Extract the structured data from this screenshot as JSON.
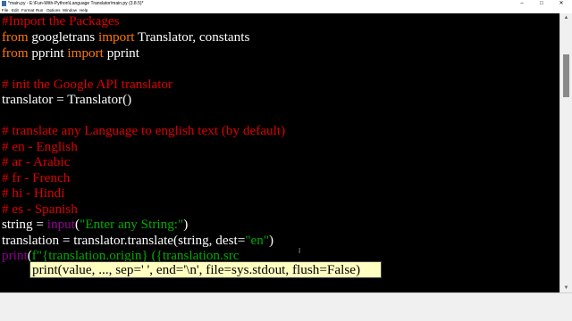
{
  "window": {
    "title": "*main.py - E:\\Fun-With-Python\\Language Translator\\main.py (3.8.5)*",
    "minimize_glyph": "–",
    "maximize_glyph": "□",
    "close_glyph": "✕"
  },
  "menu": [
    "File",
    "Edit",
    "Format",
    "Run",
    "Options",
    "Window",
    "Help"
  ],
  "code": {
    "line1_comment": "#Import the Packages",
    "line2_from": "from",
    "line2_mod": " googletrans ",
    "line2_import": "import",
    "line2_names": " Translator, constants",
    "line4_from": "from",
    "line4_mod": " pprint ",
    "line4_import": "import",
    "line4_names": " pprint",
    "line6_comment": "# init the Google API translator",
    "line7": "translator = Translator()",
    "line9_comment": "# translate any Language to english text (by default)",
    "line10_comment": "# en - English",
    "line11_comment": "# ar - Arabic",
    "line12_comment": "# fr - French",
    "line13_comment": "# hi - Hindi",
    "line14_comment": "# es - Spanish",
    "line15_pre": "string = ",
    "line15_fn": "input",
    "line15_open": "(",
    "line15_str": "\"Enter any String:\"",
    "line15_close": ")",
    "line16_pre": "translation = translator.translate(string, dest=",
    "line16_str": "\"en\"",
    "line16_close": ")",
    "line17_fn": "print",
    "line17_open": "(",
    "line17_str": "f\"{translation.origin} ({translation.src"
  },
  "calltip": {
    "text": "print(value, ..., sep=' ', end='\\n', file=sys.stdout, flush=False)"
  },
  "cursor_glyph": "I",
  "scroll": {
    "up_glyph": "▲",
    "down_glyph": "▼"
  },
  "colors": {
    "keyword": "#ff7700",
    "comment": "#dd0000",
    "string": "#00aa00",
    "builtin": "#900090",
    "calltip_bg": "#ffffc0"
  }
}
